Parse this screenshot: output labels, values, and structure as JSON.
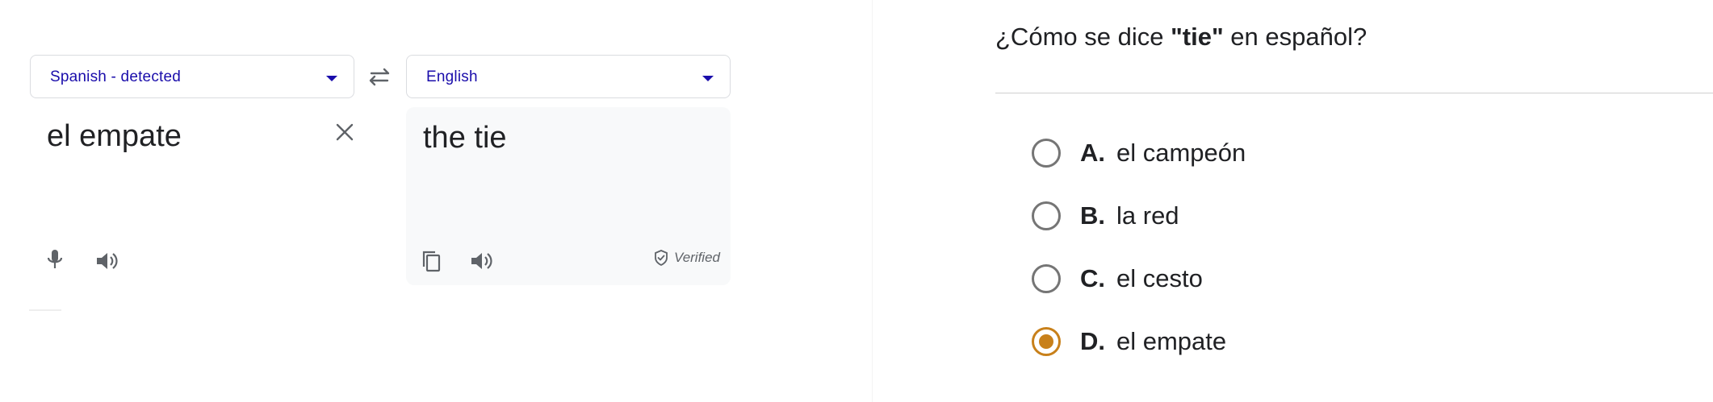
{
  "translate": {
    "source_language": "Spanish - detected",
    "target_language": "English",
    "source_text": "el empate",
    "translated_text": "the tie",
    "verified_label": "Verified",
    "accent_color": "#1a0dab"
  },
  "quiz": {
    "question_prefix": "¿Cómo se dice ",
    "question_term": "\"tie\"",
    "question_suffix": " en español?",
    "selected_color": "#c8801a",
    "options": [
      {
        "letter": "A.",
        "text": "el campeón",
        "selected": false
      },
      {
        "letter": "B.",
        "text": "la red",
        "selected": false
      },
      {
        "letter": "C.",
        "text": "el cesto",
        "selected": false
      },
      {
        "letter": "D.",
        "text": "el empate",
        "selected": true
      }
    ]
  },
  "icons": [
    "swap-icon",
    "close-icon",
    "microphone-icon",
    "speaker-icon",
    "copy-icon",
    "verified-shield-icon",
    "chevron-down-icon"
  ]
}
